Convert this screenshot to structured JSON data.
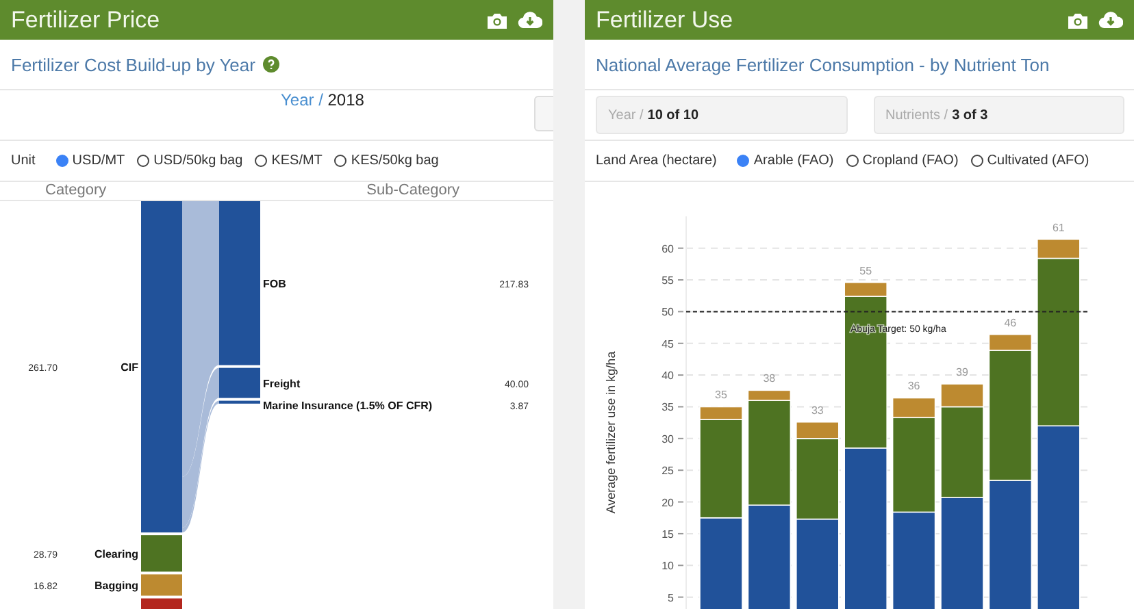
{
  "price_panel": {
    "title": "Fertilizer Price",
    "subtitle": "Fertilizer Cost Build-up by Year",
    "year_filter": {
      "label": "Year /",
      "value": "2018"
    },
    "unit": {
      "label": "Unit",
      "options": [
        {
          "label": "USD/MT",
          "selected": true
        },
        {
          "label": "USD/50kg bag",
          "selected": false
        },
        {
          "label": "KES/MT",
          "selected": false
        },
        {
          "label": "KES/50kg bag",
          "selected": false
        }
      ]
    },
    "columns": [
      "Category",
      "Sub-Category"
    ],
    "sankey": {
      "categories": [
        {
          "label": "CIF",
          "value": "261.70",
          "color": "#21529a"
        },
        {
          "label": "Clearing",
          "value": "28.79",
          "color": "#4e7322"
        },
        {
          "label": "Bagging",
          "value": "16.82",
          "color": "#bd8a30"
        },
        {
          "color": "#b3261e"
        }
      ],
      "subcategories": [
        {
          "label": "FOB",
          "value": "217.83"
        },
        {
          "label": "Freight",
          "value": "40.00"
        },
        {
          "label": "Marine Insurance (1.5% OF CFR)",
          "value": "3.87"
        }
      ]
    }
  },
  "use_panel": {
    "title": "Fertilizer Use",
    "subtitle": "National Average Fertilizer Consumption - by Nutrient Ton",
    "filters": [
      {
        "label": "Year /",
        "value": "10 of 10"
      },
      {
        "label": "Nutrients /",
        "value": "3 of 3"
      }
    ],
    "land_area": {
      "label": "Land Area (hectare)",
      "options": [
        {
          "label": "Arable (FAO)",
          "selected": true
        },
        {
          "label": "Cropland (FAO)",
          "selected": false
        },
        {
          "label": "Cultivated (AFO)",
          "selected": false
        }
      ]
    },
    "chart_data": {
      "type": "bar",
      "stacked": true,
      "grid": true,
      "ylim": [
        0,
        65
      ],
      "ylabel": "Average fertilizer use in kg/ha",
      "yticks": [
        5,
        10,
        15,
        20,
        25,
        30,
        35,
        40,
        45,
        50,
        55,
        60
      ],
      "value_labels": [
        [
          null,
          null,
          null,
          null,
          null,
          null,
          null,
          null
        ],
        [
          null,
          null,
          null,
          null,
          null,
          null,
          null,
          null
        ],
        [
          "35",
          "38",
          "33",
          "55",
          "36",
          "39",
          "46",
          "61"
        ]
      ],
      "series": [
        {
          "color": "#21529a",
          "values": [
            17.5,
            19.5,
            17.3,
            28.5,
            18.4,
            20.7,
            23.4,
            32
          ]
        },
        {
          "color": "#4e7322",
          "values": [
            15.5,
            16.5,
            12.7,
            23.9,
            14.9,
            14.3,
            20.5,
            26.4
          ]
        },
        {
          "color": "#bd8a30",
          "values": [
            2,
            1.6,
            2.6,
            2.2,
            3.1,
            3.6,
            2.5,
            3
          ]
        }
      ],
      "ref_lines": [
        {
          "axis": "y",
          "value": 50,
          "label": "Abuja Target: 50 kg/ha"
        }
      ]
    }
  }
}
